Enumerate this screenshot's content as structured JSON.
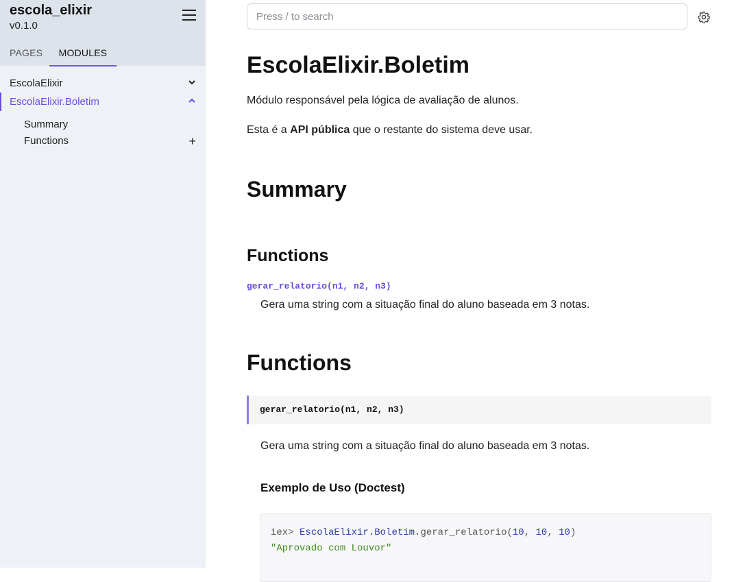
{
  "sidebar": {
    "project_name": "escola_elixir",
    "version": "v0.1.0",
    "tabs": [
      "PAGES",
      "MODULES"
    ],
    "nav_items": [
      "EscolaElixir",
      "EscolaElixir.Boletim"
    ],
    "sub_items": [
      "Summary",
      "Functions"
    ],
    "accent_color": "#6a4cd9"
  },
  "search": {
    "placeholder": "Press / to search"
  },
  "main": {
    "title": "EscolaElixir.Boletim",
    "intro": "Módulo responsável pela lógica de avaliação de alunos.",
    "api_pre": "Esta é a ",
    "api_bold": "API pública",
    "api_post": " que o restante do sistema deve usar.",
    "summary_heading": "Summary",
    "summary_functions_heading": "Functions",
    "summary_function_link": "gerar_relatorio(n1, n2, n3)",
    "summary_function_desc": "Gera uma string com a situação final do aluno baseada em 3 notas.",
    "functions_heading": "Functions",
    "function_signature": "gerar_relatorio(n1, n2, n3)",
    "function_desc": "Gera uma string com a situação final do aluno baseada em 3 notas.",
    "example_heading": "Exemplo de Uso (Doctest)",
    "code": {
      "prompt": "iex> ",
      "module": "EscolaElixir.Boletim",
      "call": ".gerar_relatorio(",
      "args": [
        "10",
        "10",
        "10"
      ],
      "result": "\"Aprovado com Louvor\""
    }
  }
}
